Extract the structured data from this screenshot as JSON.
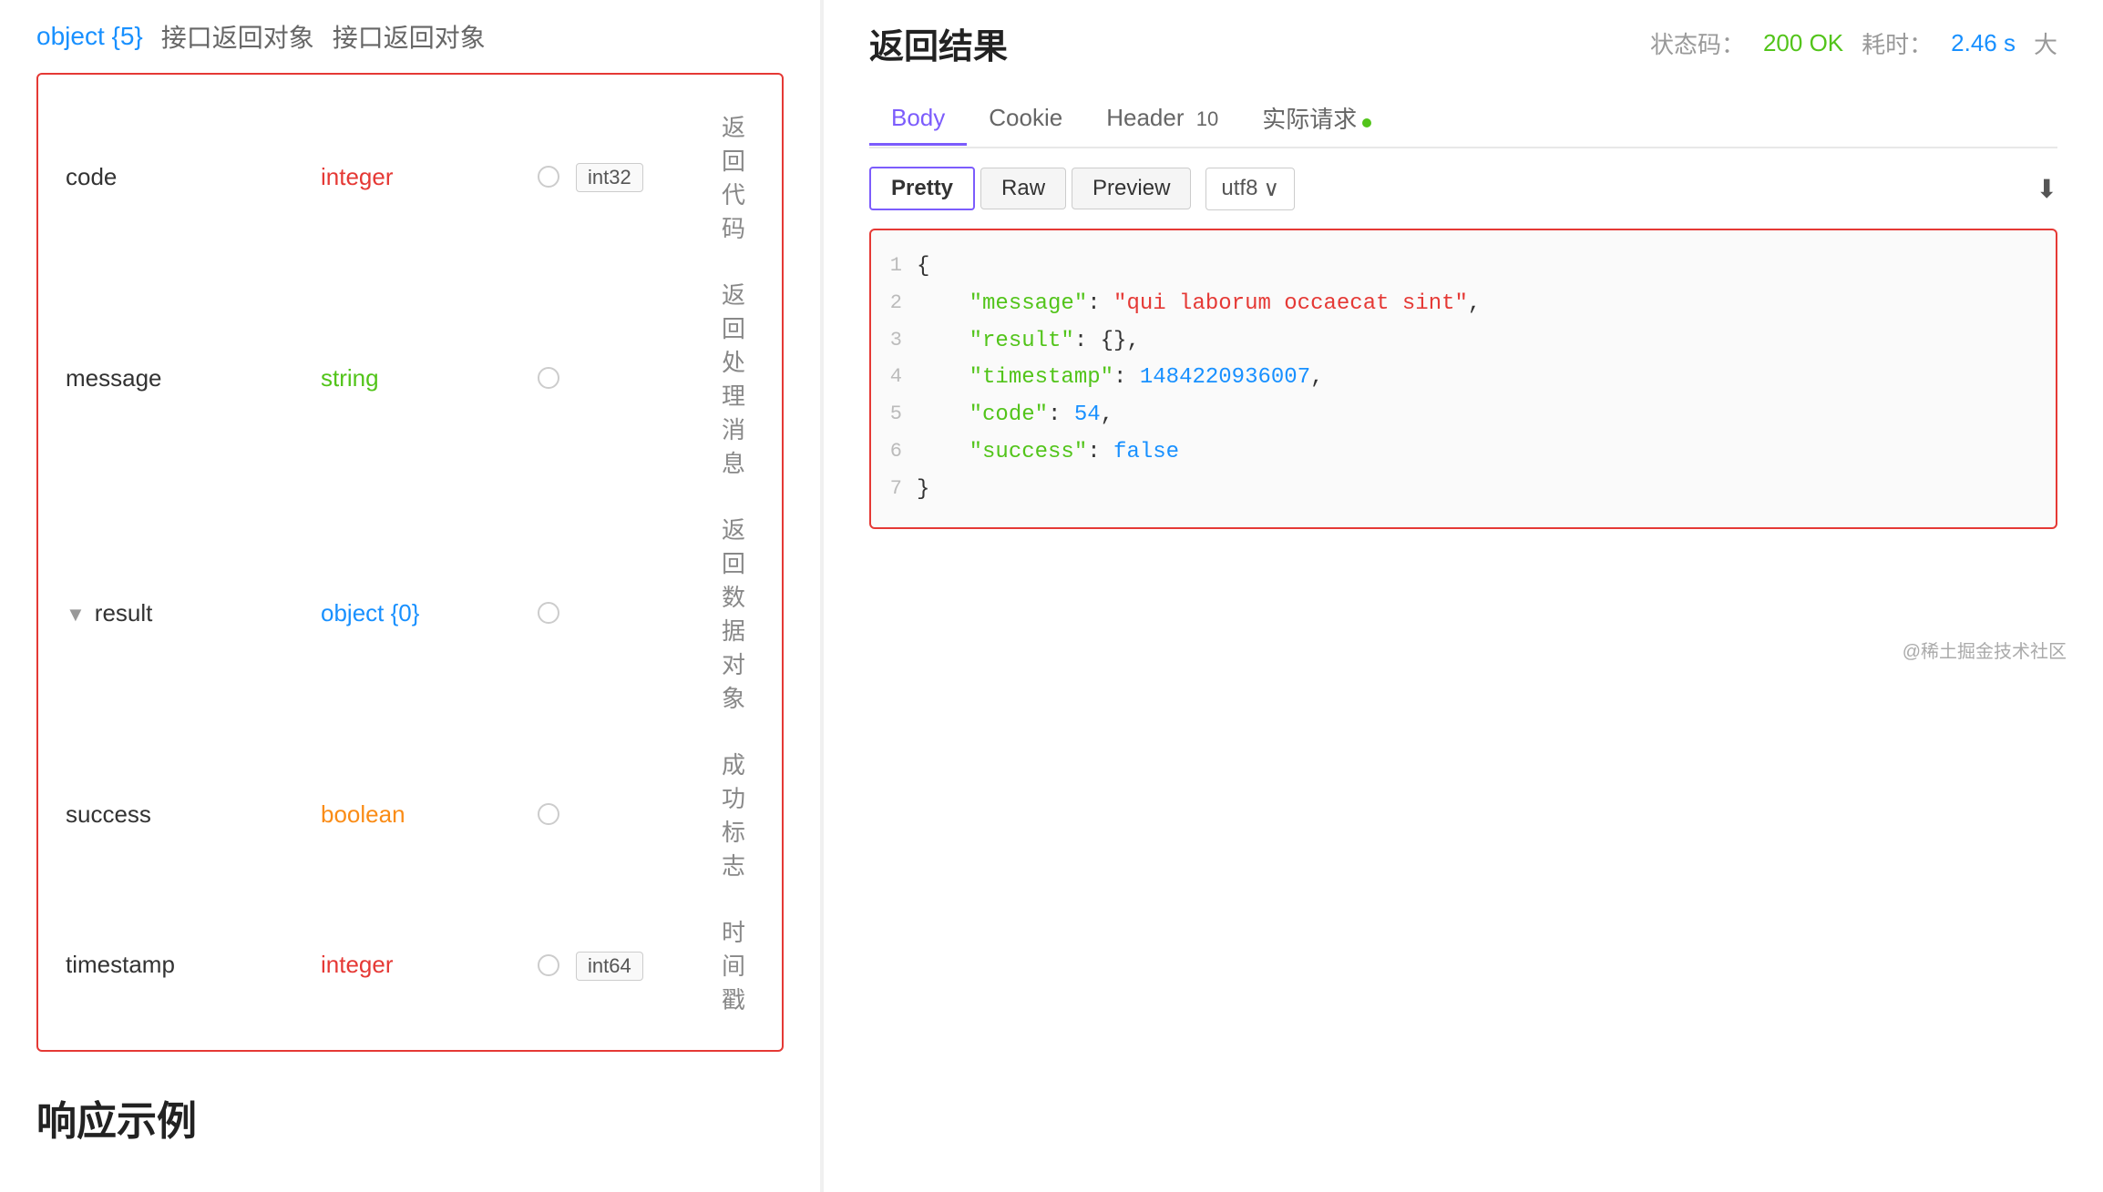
{
  "left": {
    "object_header": {
      "type": "object {5}",
      "label1": "接口返回对象",
      "label2": "接口返回对象"
    },
    "schema_rows": [
      {
        "name": "code",
        "type": "integer",
        "type_class": "integer",
        "has_radio": true,
        "format": "int32",
        "desc": "返回代码"
      },
      {
        "name": "message",
        "type": "string",
        "type_class": "string",
        "has_radio": true,
        "format": "",
        "desc": "返回处理消息"
      },
      {
        "name": "result",
        "type": "object {0}",
        "type_class": "object",
        "has_radio": true,
        "format": "",
        "desc": "返回数据对象",
        "expandable": true
      },
      {
        "name": "success",
        "type": "boolean",
        "type_class": "boolean",
        "has_radio": true,
        "format": "",
        "desc": "成功标志"
      },
      {
        "name": "timestamp",
        "type": "integer",
        "type_class": "integer",
        "has_radio": true,
        "format": "int64",
        "desc": "时间戳"
      }
    ],
    "section_title": "响应示例"
  },
  "right": {
    "title": "返回结果",
    "meta": {
      "status_label": "状态码：",
      "status_value": "200 OK",
      "time_label": "耗时：",
      "time_value": "2.46 s",
      "size_label": "大"
    },
    "tabs": [
      {
        "label": "Body",
        "active": true
      },
      {
        "label": "Cookie",
        "active": false
      },
      {
        "label": "Header",
        "badge": "10",
        "active": false
      },
      {
        "label": "实际请求",
        "dot": true,
        "active": false
      }
    ],
    "format_buttons": [
      {
        "label": "Pretty",
        "active": true
      },
      {
        "label": "Raw",
        "active": false
      },
      {
        "label": "Preview",
        "active": false
      }
    ],
    "encoding": "utf8",
    "code_lines": [
      {
        "num": "1",
        "content": "{"
      },
      {
        "num": "2",
        "content": "    \"message\": \"qui laborum occaecat sint\","
      },
      {
        "num": "3",
        "content": "    \"result\": {},"
      },
      {
        "num": "4",
        "content": "    \"timestamp\": 1484220936007,"
      },
      {
        "num": "5",
        "content": "    \"code\": 54,"
      },
      {
        "num": "6",
        "content": "    \"success\": false"
      },
      {
        "num": "7",
        "content": "}"
      }
    ]
  },
  "footer": {
    "text": "@稀土掘金技术社区"
  }
}
